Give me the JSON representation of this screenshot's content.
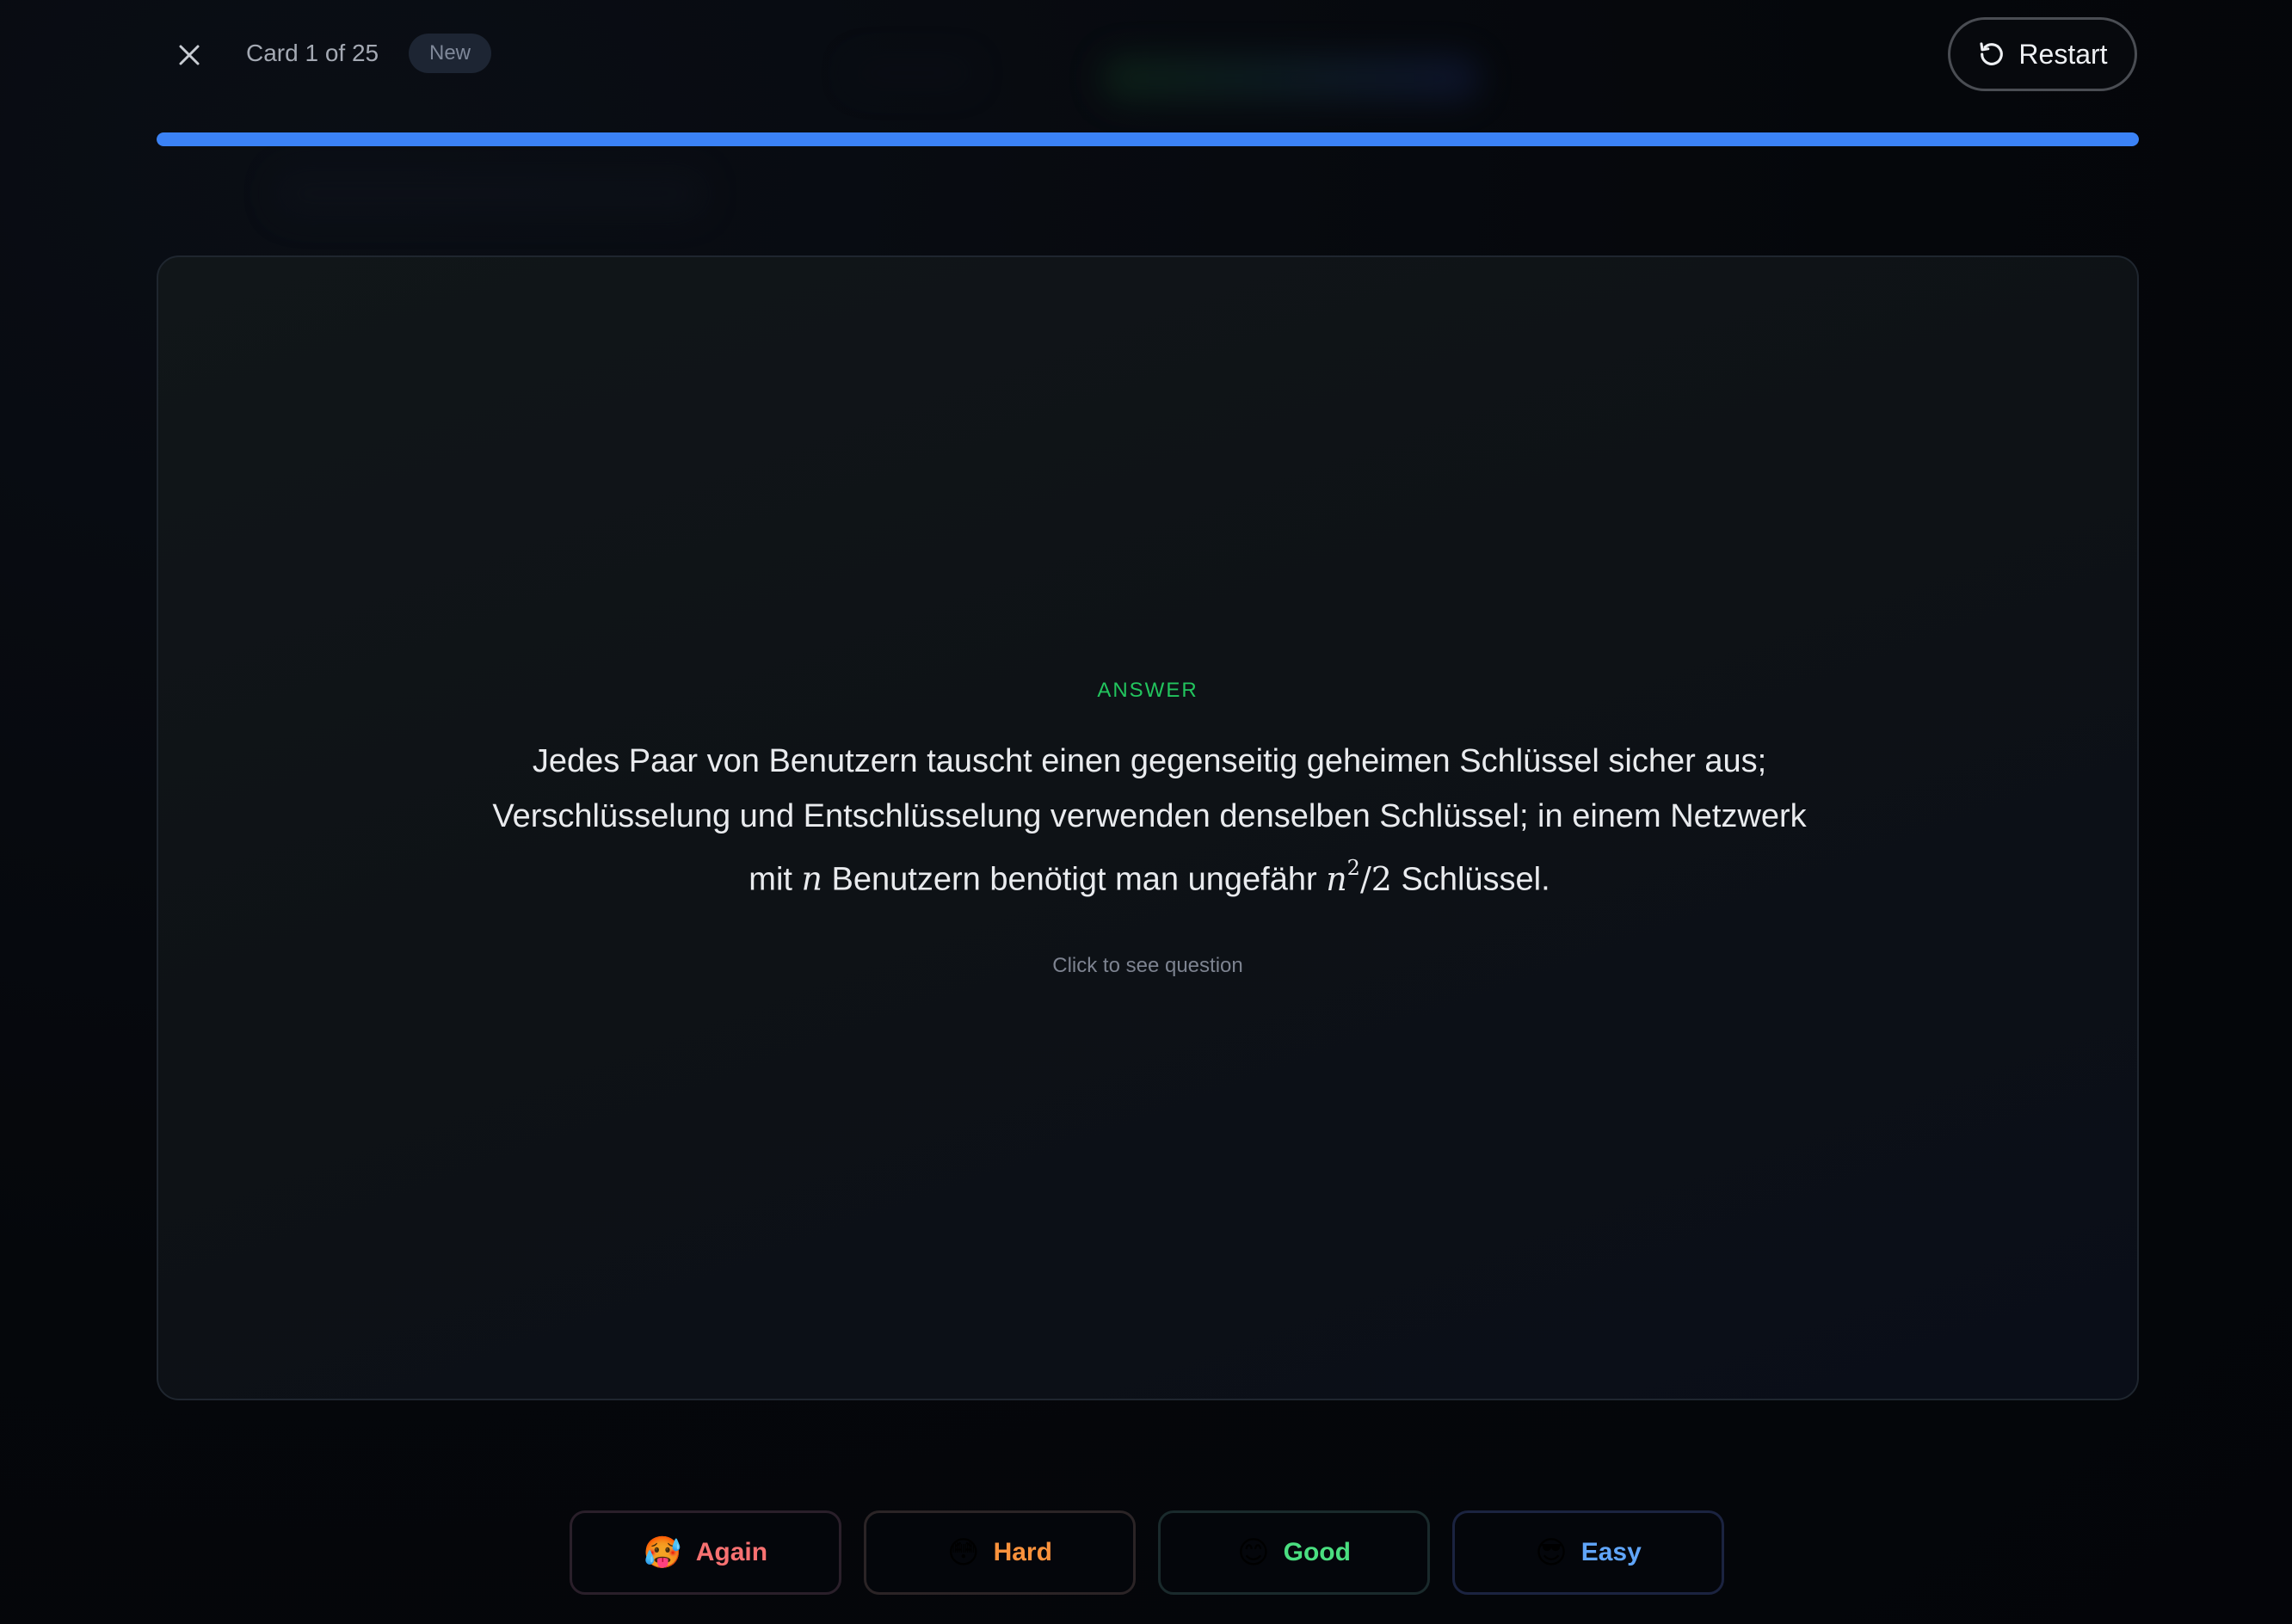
{
  "header": {
    "card_counter": "Card 1 of 25",
    "status_badge": "New",
    "restart_label": "Restart"
  },
  "progress": {
    "fraction": 1.0,
    "color": "#3b82f6"
  },
  "card": {
    "side_label": "ANSWER",
    "answer_part1": "Jedes Paar von Benutzern tauscht einen gegenseitig geheimen Schlüssel sicher aus; Verschlüsselung und Entschlüsselung verwenden denselben Schlüssel; in einem Netzwerk mit ",
    "answer_var": "n",
    "answer_part2": " Benutzern benötigt man ungefähr ",
    "answer_math_base": "n",
    "answer_math_exp": "2",
    "answer_math_rest": "/2",
    "answer_part3": " Schlüssel.",
    "flip_hint": "Click to see question"
  },
  "ratings": [
    {
      "label": "Again",
      "emoji": "🥵",
      "color": "#f87171"
    },
    {
      "label": "Hard",
      "emoji": "😳",
      "color": "#fb923c"
    },
    {
      "label": "Good",
      "emoji": "😊",
      "color": "#4ade80"
    },
    {
      "label": "Easy",
      "emoji": "😎",
      "color": "#60a5fa"
    }
  ],
  "icons": {
    "close": "close-icon",
    "restart": "restart-icon"
  }
}
